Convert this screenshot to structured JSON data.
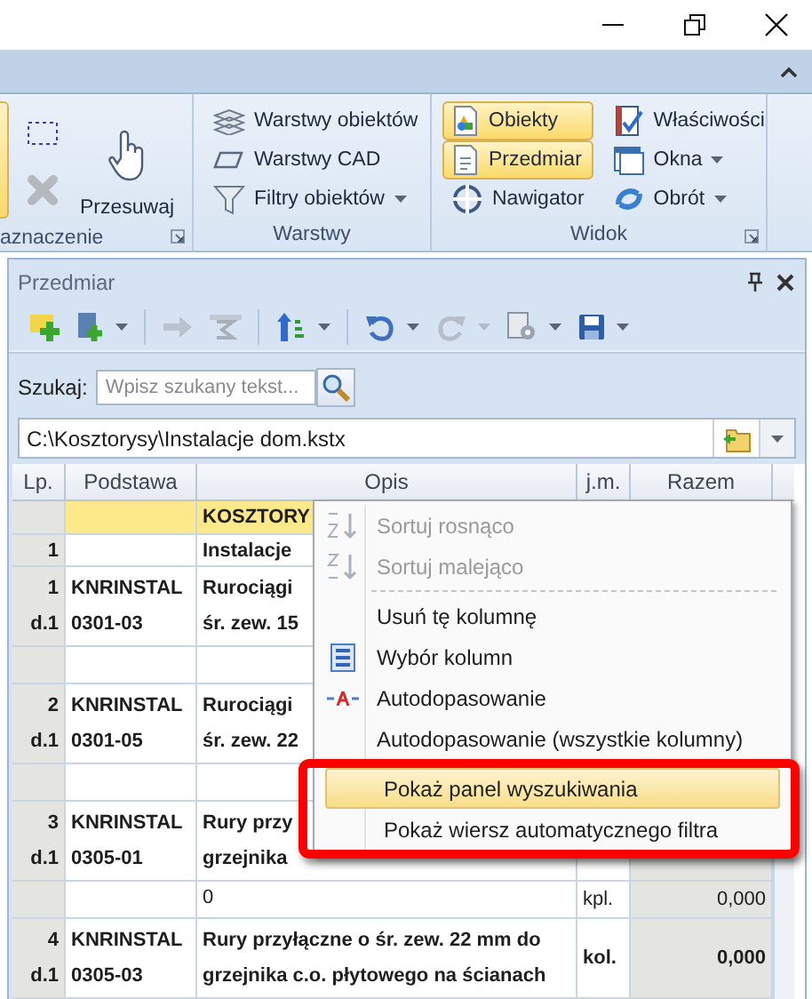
{
  "ribbon": {
    "groups": [
      {
        "label": "aznaczenie",
        "launcher": true,
        "columns": [
          [
            {
              "kind": "edge",
              "selected": true
            }
          ],
          [
            {
              "kind": "icon",
              "disabled": false
            },
            {
              "kind": "icon",
              "disabled": true
            }
          ],
          [
            {
              "kind": "large",
              "label": "Przesuwaj"
            }
          ]
        ]
      },
      {
        "label": "Warstwy",
        "launcher": false,
        "columns": [
          [
            {
              "kind": "small",
              "label": "Warstwy obiektów",
              "dropdown": false,
              "selected": false
            },
            {
              "kind": "small",
              "label": "Warstwy CAD",
              "dropdown": false,
              "selected": false
            },
            {
              "kind": "small",
              "label": "Filtry obiektów",
              "dropdown": true,
              "selected": false
            }
          ]
        ]
      },
      {
        "label": "Widok",
        "launcher": true,
        "columns": [
          [
            {
              "kind": "small",
              "label": "Obiekty",
              "dropdown": false,
              "selected": true
            },
            {
              "kind": "small",
              "label": "Przedmiar",
              "dropdown": false,
              "selected": true
            },
            {
              "kind": "small",
              "label": "Nawigator",
              "dropdown": false,
              "selected": false
            }
          ],
          [
            {
              "kind": "small",
              "label": "Właściwości",
              "dropdown": false,
              "selected": false
            },
            {
              "kind": "small",
              "label": "Okna",
              "dropdown": true,
              "selected": false
            },
            {
              "kind": "small",
              "label": "Obrót",
              "dropdown": true,
              "selected": false
            }
          ]
        ]
      }
    ]
  },
  "panel": {
    "title": "Przedmiar",
    "toolbar": [
      {
        "kind": "button",
        "disabled": false,
        "dropdown": false
      },
      {
        "kind": "button",
        "disabled": false,
        "dropdown": true
      },
      {
        "kind": "separator"
      },
      {
        "kind": "button",
        "disabled": true,
        "dropdown": false
      },
      {
        "kind": "button",
        "disabled": true,
        "dropdown": false
      },
      {
        "kind": "separator"
      },
      {
        "kind": "button",
        "disabled": false,
        "dropdown": true
      },
      {
        "kind": "separator"
      },
      {
        "kind": "button",
        "disabled": false,
        "dropdown": true
      },
      {
        "kind": "button",
        "disabled": true,
        "dropdown": true
      },
      {
        "kind": "button",
        "disabled": false,
        "dropdown": true
      },
      {
        "kind": "button",
        "disabled": false,
        "dropdown": true
      }
    ],
    "search": {
      "label": "Szukaj:",
      "placeholder": "Wpisz szukany tekst..."
    },
    "path": "C:\\Kosztorysy\\Instalacje dom.kstx",
    "table": {
      "columns": [
        "Lp.",
        "Podstawa",
        "Opis",
        "j.m.",
        "Razem"
      ],
      "rows": [
        {
          "kind": "chapter",
          "lp": [],
          "podstawa": [],
          "opis": [
            "KOSZTORY"
          ],
          "jm": "",
          "razem": ""
        },
        {
          "kind": "section",
          "lp": [
            "1"
          ],
          "podstawa": [],
          "opis": [
            "Instalacje"
          ],
          "jm": "",
          "razem": ""
        },
        {
          "kind": "position",
          "lp": [
            "1",
            "d.1"
          ],
          "podstawa": [
            "KNRINSTAL",
            "0301-03"
          ],
          "opis": [
            "Rurociągi",
            "śr. zew. 15"
          ],
          "jm": "",
          "razem": ""
        },
        {
          "kind": "quantity",
          "lp": [],
          "podstawa": [],
          "opis": [],
          "jm": "",
          "razem": ""
        },
        {
          "kind": "position",
          "lp": [
            "2",
            "d.1"
          ],
          "podstawa": [
            "KNRINSTAL",
            "0301-05"
          ],
          "opis": [
            "Rurociągi",
            "śr. zew. 22"
          ],
          "jm": "",
          "razem": ""
        },
        {
          "kind": "quantity",
          "lp": [],
          "podstawa": [],
          "opis": [],
          "jm": "",
          "razem": ""
        },
        {
          "kind": "position",
          "lp": [
            "3",
            "d.1"
          ],
          "podstawa": [
            "KNRINSTAL",
            "0305-01"
          ],
          "opis": [
            "Rury przy",
            "grzejnika"
          ],
          "jm": "",
          "razem": ""
        },
        {
          "kind": "quantity",
          "lp": [],
          "podstawa": [],
          "opis": [
            "0"
          ],
          "jm": "kpl.",
          "razem": "0,000"
        },
        {
          "kind": "position",
          "lp": [
            "4",
            "d.1"
          ],
          "podstawa": [
            "KNRINSTAL",
            "0305-03"
          ],
          "opis": [
            "Rury przyłączne o śr. zew. 22 mm do",
            "grzejnika c.o. płytowego na ścianach"
          ],
          "jm": "kol.",
          "razem": "0,000"
        }
      ]
    }
  },
  "context_menu": {
    "items": [
      {
        "kind": "item",
        "label": "Sortuj rosnąco",
        "disabled": true,
        "selected": false,
        "framed": false
      },
      {
        "kind": "item",
        "label": "Sortuj malejąco",
        "disabled": true,
        "selected": false,
        "framed": false
      },
      {
        "kind": "separator"
      },
      {
        "kind": "item",
        "label": "Usuń tę kolumnę",
        "disabled": false,
        "selected": false,
        "framed": false
      },
      {
        "kind": "item",
        "label": "Wybór kolumn",
        "disabled": false,
        "selected": false,
        "framed": false
      },
      {
        "kind": "item",
        "label": "Autodopasowanie",
        "disabled": false,
        "selected": false,
        "framed": false
      },
      {
        "kind": "item",
        "label": "Autodopasowanie (wszystkie kolumny)",
        "disabled": false,
        "selected": false,
        "framed": false
      },
      {
        "kind": "item",
        "label": "Pokaż panel wyszukiwania",
        "disabled": false,
        "selected": true,
        "framed": true
      },
      {
        "kind": "item",
        "label": "Pokaż wiersz automatycznego filtra",
        "disabled": false,
        "selected": false,
        "framed": true
      }
    ]
  }
}
